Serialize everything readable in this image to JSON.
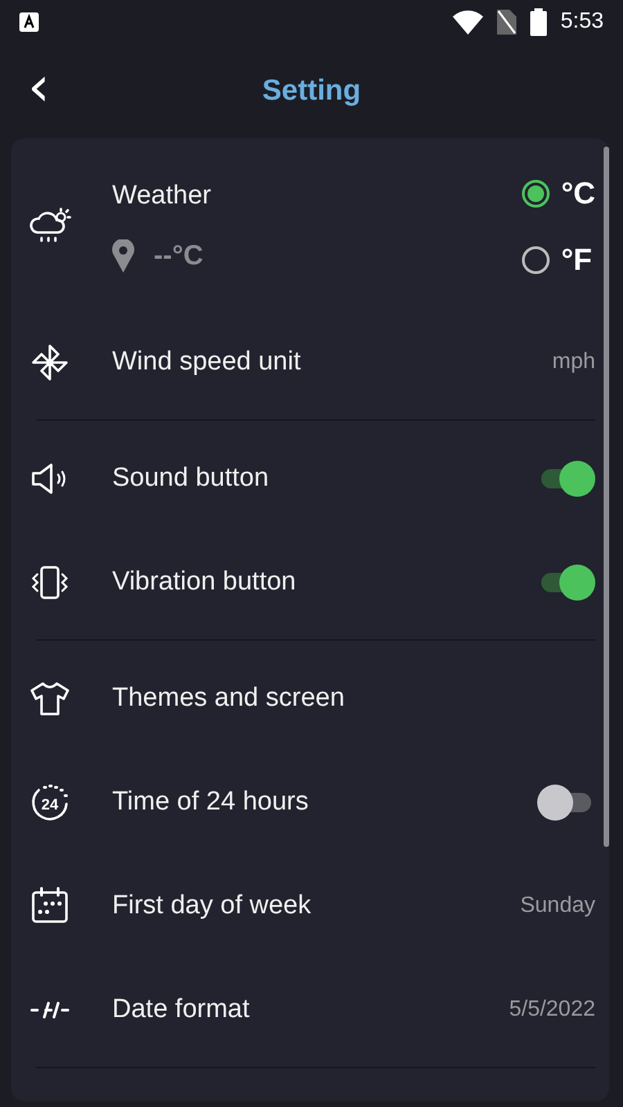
{
  "status_bar": {
    "time": "5:53"
  },
  "header": {
    "back": "‹",
    "title": "Setting"
  },
  "sections": [
    {
      "items": [
        {
          "kind": "weather",
          "label": "Weather",
          "temperature": "--°C",
          "units": [
            {
              "label": "°C",
              "selected": true
            },
            {
              "label": "°F",
              "selected": false
            }
          ]
        },
        {
          "kind": "value",
          "label": "Wind speed unit",
          "value": "mph"
        }
      ]
    },
    {
      "items": [
        {
          "kind": "toggle",
          "label": "Sound button",
          "on": true
        },
        {
          "kind": "toggle",
          "label": "Vibration button",
          "on": true
        }
      ]
    },
    {
      "items": [
        {
          "kind": "link",
          "label": "Themes and screen"
        },
        {
          "kind": "toggle",
          "icon_text": "24",
          "label": "Time of 24 hours",
          "on": false
        },
        {
          "kind": "value",
          "label": "First day of week",
          "value": "Sunday"
        },
        {
          "kind": "value",
          "label": "Date format",
          "value": "5/5/2022"
        }
      ]
    }
  ]
}
